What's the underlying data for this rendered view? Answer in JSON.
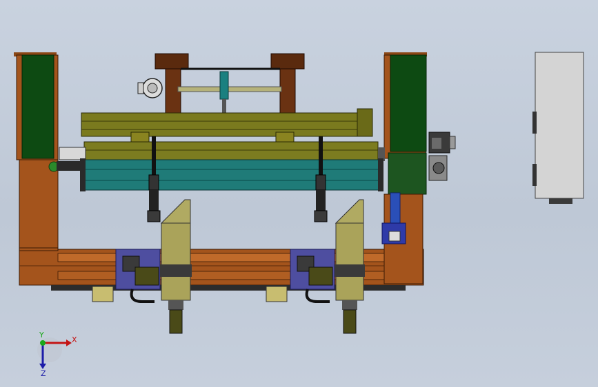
{
  "triad": {
    "x_label": "X",
    "y_label": "Y",
    "z_label": "Z"
  },
  "colors": {
    "background": "#c4cdda",
    "frame_rust": "#a4541c",
    "frame_green": "#0d4a12",
    "olive_beam": "#7a7a1e",
    "teal_roller": "#1f7b78",
    "brown_bracket": "#5a2a0e",
    "carriage_khaki": "#b0aa62",
    "purple_block": "#4e4ea0",
    "cabinet_gray": "#d4d4d4"
  }
}
